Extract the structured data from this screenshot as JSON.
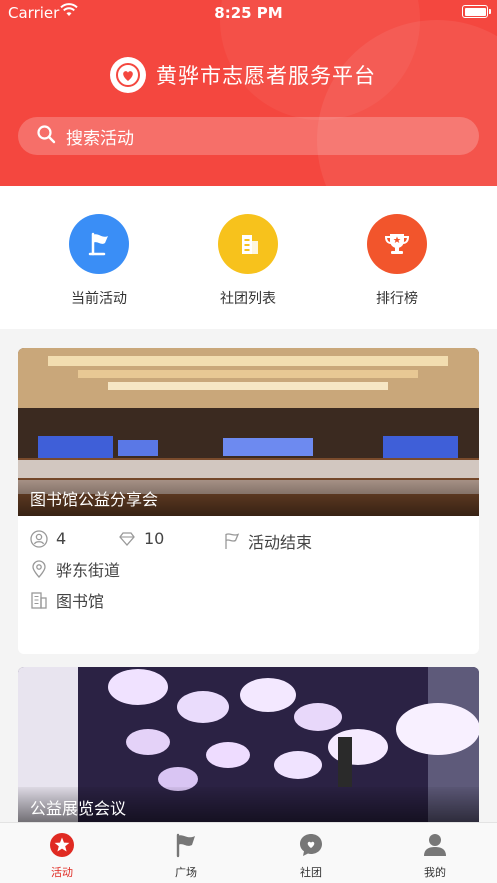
{
  "status_bar": {
    "carrier": "Carrier",
    "time": "8:25 PM"
  },
  "header": {
    "title": "黄骅市志愿者服务平台"
  },
  "search": {
    "placeholder": "搜索活动"
  },
  "quick_links": [
    {
      "label": "当前活动",
      "icon": "flag-icon",
      "color": "#3a8ef6"
    },
    {
      "label": "社团列表",
      "icon": "building-icon",
      "color": "#f7c21c"
    },
    {
      "label": "排行榜",
      "icon": "trophy-icon",
      "color": "#f2552c"
    }
  ],
  "activities": [
    {
      "title": "图书馆公益分享会",
      "participants": "4",
      "points": "10",
      "status": "活动结束",
      "location": "骅东街道",
      "organization": "图书馆"
    },
    {
      "title": "公益展览会议"
    }
  ],
  "tab_bar": [
    {
      "label": "活动",
      "icon": "star-icon",
      "active": true
    },
    {
      "label": "广场",
      "icon": "flag-icon",
      "active": false
    },
    {
      "label": "社团",
      "icon": "chat-heart-icon",
      "active": false
    },
    {
      "label": "我的",
      "icon": "user-icon",
      "active": false
    }
  ],
  "colors": {
    "brand_red": "#f4473f",
    "active_tab": "#e02a22"
  }
}
